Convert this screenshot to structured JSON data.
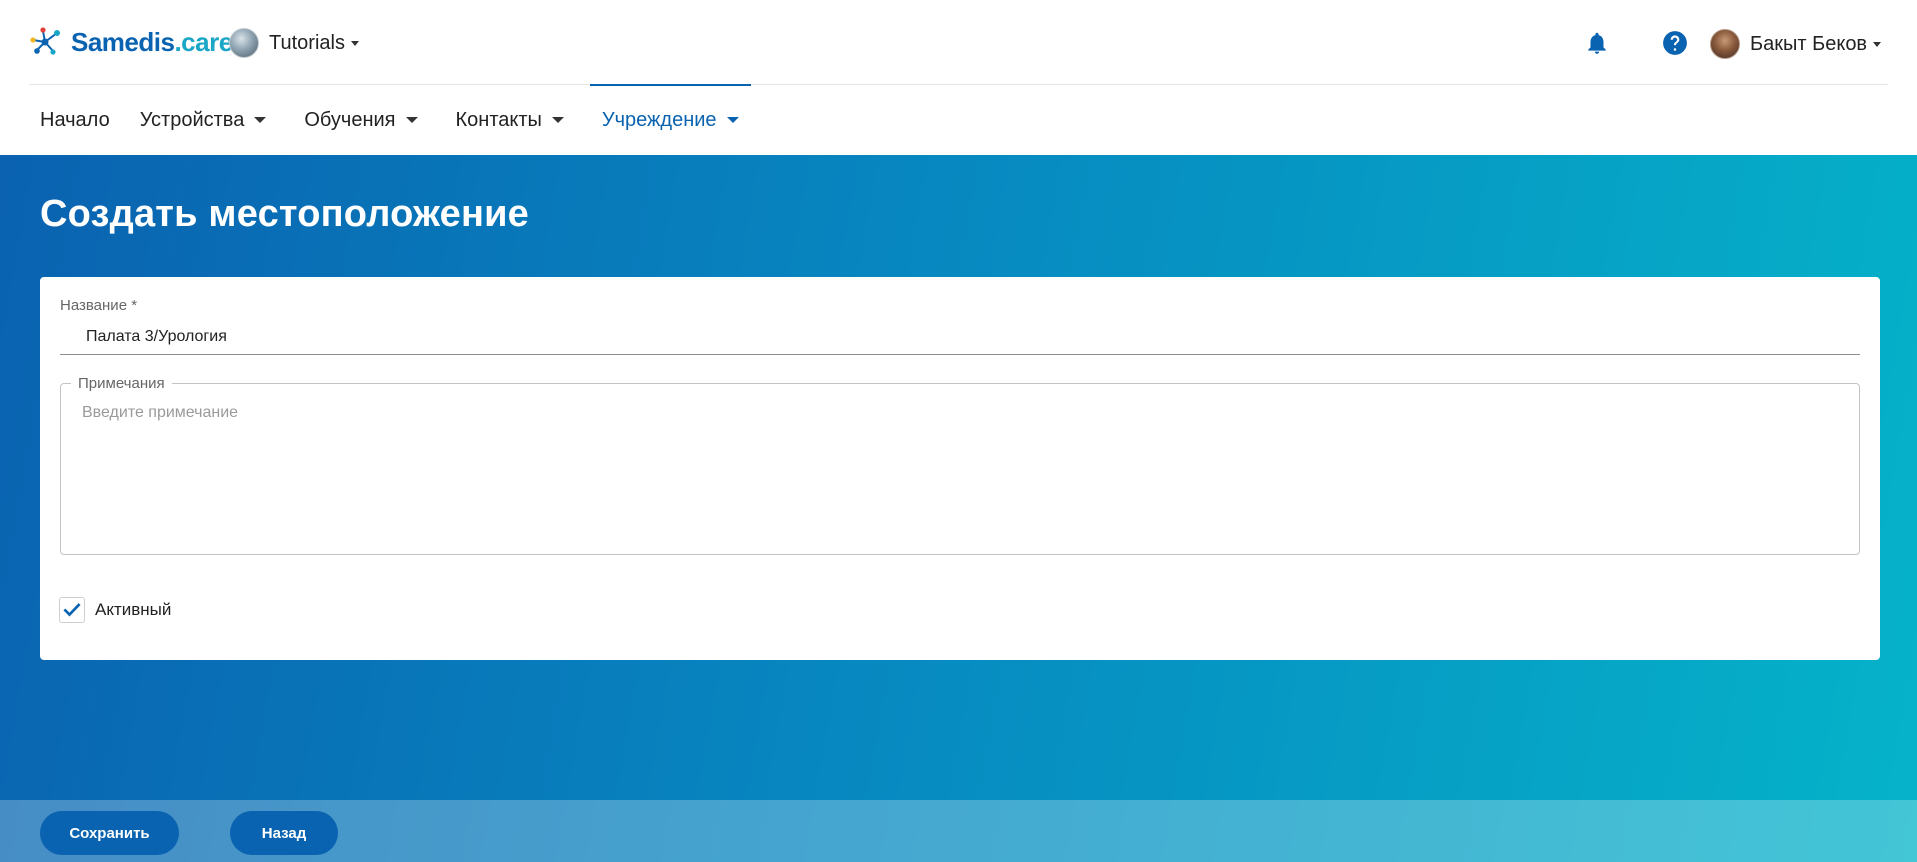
{
  "header": {
    "logo": {
      "name": "Samedis",
      "suffix": ".care"
    },
    "tenant": {
      "label": "Tutorials"
    },
    "user": {
      "name": "Бакыт Беков"
    }
  },
  "nav": {
    "items": [
      {
        "label": "Начало",
        "has_dropdown": false
      },
      {
        "label": "Устройства",
        "has_dropdown": true
      },
      {
        "label": "Обучения",
        "has_dropdown": true
      },
      {
        "label": "Контакты",
        "has_dropdown": true
      },
      {
        "label": "Учреждение",
        "has_dropdown": true,
        "active": true
      }
    ]
  },
  "page": {
    "title": "Создать местоположение"
  },
  "form": {
    "name_label": "Название *",
    "name_value": "Палата 3/Урология",
    "notes_label": "Примечания",
    "notes_placeholder": "Введите примечание",
    "active_label": "Активный",
    "active_checked": true
  },
  "footer": {
    "save_label": "Сохранить",
    "back_label": "Назад"
  },
  "colors": {
    "brand_primary": "#0a63b0",
    "brand_secondary": "#1aa6c6",
    "gradient_start": "#0a62b0",
    "gradient_end": "#05b3c9"
  },
  "icons": {
    "logo": "molecule-network-icon",
    "notifications": "bell-icon",
    "help": "question-circle-icon",
    "checkbox": "checkmark-icon",
    "dropdown": "caret-down-icon"
  }
}
